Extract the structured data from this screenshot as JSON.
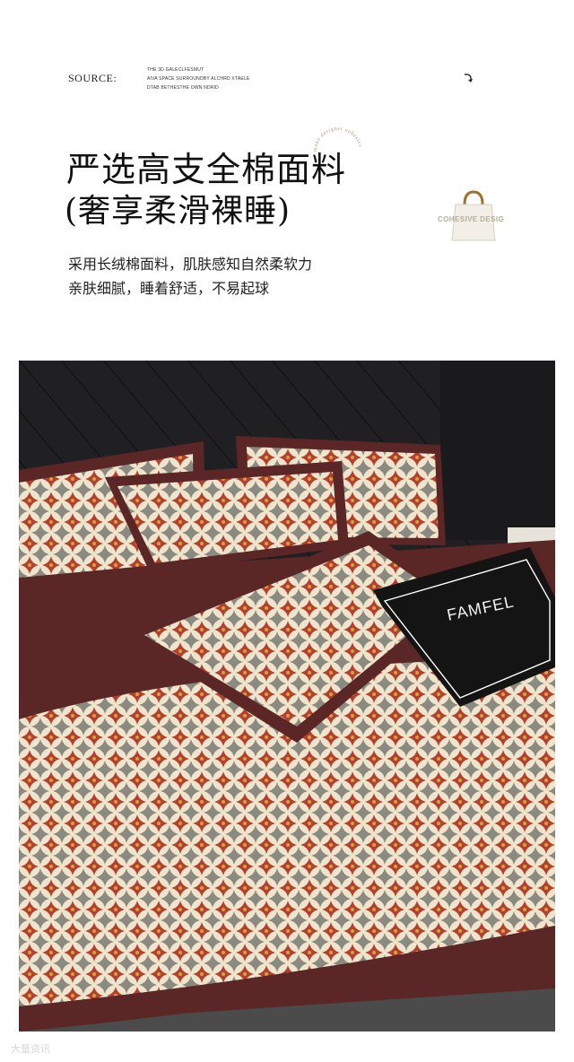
{
  "header": {
    "source_label": "SOURCE:",
    "source_lines": [
      "THE 3D GALECLFESMUT",
      "AIVA SPACE SURROUNDBY ALCHRD XTAELE",
      "DTAB BETHESTHE OWN NDRID"
    ],
    "arrow_icon": "curved-arrow-icon"
  },
  "headline": {
    "line1": "严选高支全棉面料",
    "line2": "(奢享柔滑裸睡)"
  },
  "badge": {
    "ring_text": "make designer cohesive",
    "bag_caption": "COHESIVE DESIG"
  },
  "description": {
    "line1": "采用长绒棉面料，肌肤感知自然柔软力",
    "line2": "亲肤细腻，睡着舒适，不易起球"
  },
  "photo": {
    "pillow_text": "FAMFEL",
    "colors": {
      "headboard": "#1c1c1e",
      "trim": "#5a2626",
      "pattern_bg": "#efe4cc",
      "pattern_red": "#b3402f",
      "pattern_gray": "#8a8a80"
    }
  },
  "watermark": "大量资讯"
}
